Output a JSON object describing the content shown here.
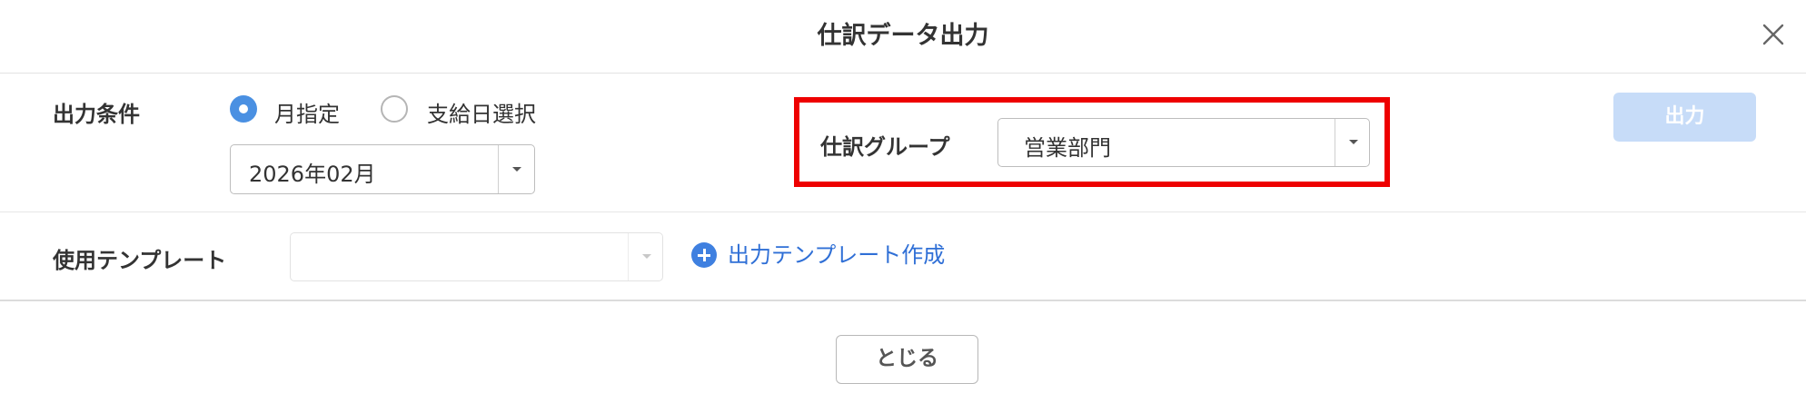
{
  "dialog": {
    "title": "仕訳データ出力",
    "close_icon": "close-icon"
  },
  "output_conditions": {
    "label": "出力条件",
    "radio_options": [
      {
        "label": "月指定",
        "selected": true
      },
      {
        "label": "支給日選択",
        "selected": false
      }
    ],
    "month_select": {
      "value": "2026年02月"
    }
  },
  "journal_group": {
    "label": "仕訳グループ",
    "value": "営業部門"
  },
  "output_button": {
    "label": "出力"
  },
  "template": {
    "label": "使用テンプレート",
    "select_value": "",
    "create_link_label": "出力テンプレート作成",
    "create_link_icon": "plus-circle-icon"
  },
  "footer": {
    "close_label": "とじる"
  },
  "colors": {
    "accent": "#4a90e2",
    "link": "#2f6fd6",
    "highlight": "#ee0000",
    "output_button_disabled": "#c7dcf8"
  }
}
